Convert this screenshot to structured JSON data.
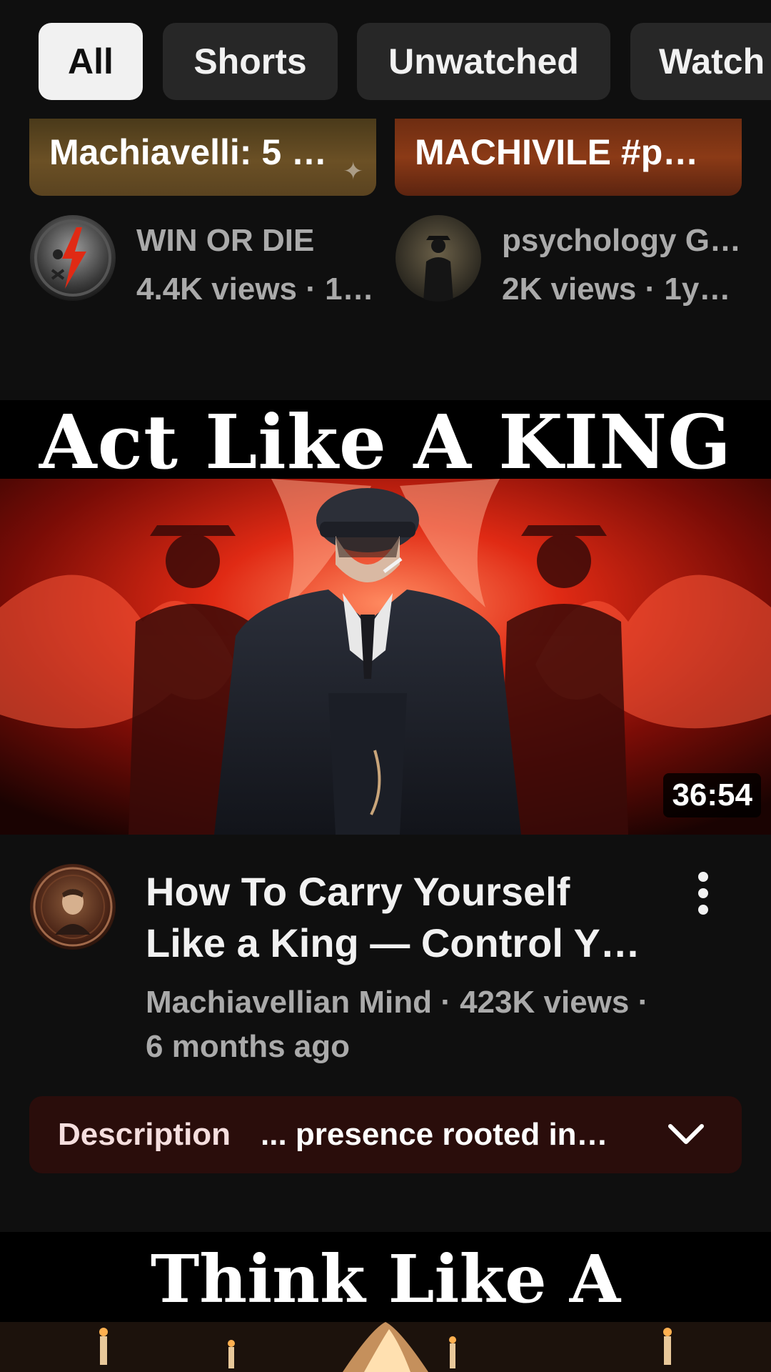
{
  "filters": {
    "chips": [
      {
        "label": "All",
        "active": true
      },
      {
        "label": "Shorts",
        "active": false
      },
      {
        "label": "Unwatched",
        "active": false
      },
      {
        "label": "Watch",
        "active": false
      }
    ]
  },
  "shorts": [
    {
      "title": "Machiavelli: 5 …",
      "channel": "WIN OR DIE",
      "views": "4.4K views · 1…",
      "avatar_icon": "lightning-skull-icon"
    },
    {
      "title": "MACHIVILE #p…",
      "channel": "psychology Gr…",
      "views": "2K views · 1y…",
      "avatar_icon": "silhouette-man-icon"
    }
  ],
  "video": {
    "thumbnail_headline": "Act Like A KING",
    "duration": "36:54",
    "title_line1": "How To Carry Yourself",
    "title_line2": "Like a King — Control Y…",
    "meta_line1": "Machiavellian Mind · 423K views ·",
    "meta_line2": "6 months ago",
    "avatar_icon": "machiavelli-portrait-icon"
  },
  "description": {
    "label": "Description",
    "text": "... presence rooted in…"
  },
  "next_video": {
    "thumbnail_headline": "Think Like A General"
  },
  "colors": {
    "background": "#0f0f0f",
    "chip_bg": "#272727",
    "chip_active_bg": "#f1f1f1",
    "description_bg": "#2a0d0b",
    "secondary_text": "#aaaaaa",
    "accent_red": "#e02a14"
  }
}
